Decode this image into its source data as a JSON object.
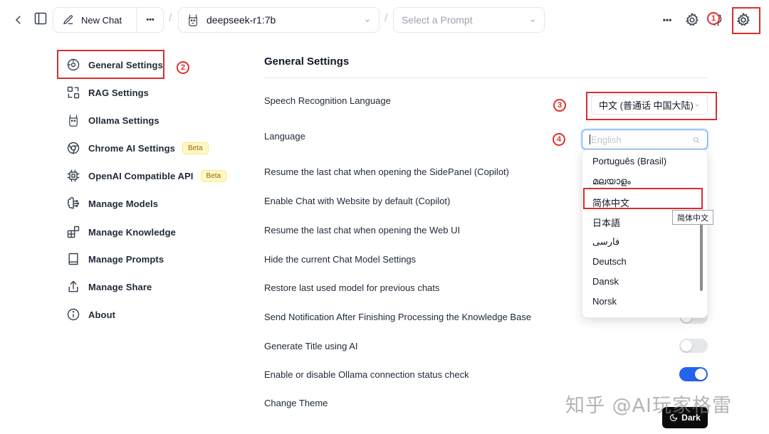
{
  "topbar": {
    "new_chat_label": "New Chat",
    "model_label": "deepseek-r1:7b",
    "prompt_placeholder": "Select a Prompt",
    "more_label": "•••",
    "separator": "/"
  },
  "sidebar": {
    "items": [
      {
        "label": "General Settings",
        "icon": "general-settings-icon"
      },
      {
        "label": "RAG Settings",
        "icon": "rag-icon"
      },
      {
        "label": "Ollama Settings",
        "icon": "ollama-icon"
      },
      {
        "label": "Chrome AI Settings",
        "icon": "chrome-icon",
        "badge": "Beta"
      },
      {
        "label": "OpenAI Compatible API",
        "icon": "cpu-icon",
        "badge": "Beta"
      },
      {
        "label": "Manage Models",
        "icon": "brain-icon"
      },
      {
        "label": "Manage Knowledge",
        "icon": "blocks-icon"
      },
      {
        "label": "Manage Prompts",
        "icon": "book-icon"
      },
      {
        "label": "Manage Share",
        "icon": "share-icon"
      },
      {
        "label": "About",
        "icon": "info-icon"
      }
    ]
  },
  "main": {
    "title": "General Settings",
    "rows": [
      {
        "label": "Speech Recognition Language"
      },
      {
        "label": "Language"
      },
      {
        "label": "Resume the last chat when opening the SidePanel (Copilot)"
      },
      {
        "label": "Enable Chat with Website by default (Copilot)"
      },
      {
        "label": "Resume the last chat when opening the Web UI"
      },
      {
        "label": "Hide the current Chat Model Settings"
      },
      {
        "label": "Restore last used model for previous chats"
      },
      {
        "label": "Send Notification After Finishing Processing the Knowledge Base",
        "toggle": false
      },
      {
        "label": "Generate Title using AI",
        "toggle": false
      },
      {
        "label": "Enable or disable Ollama connection status check",
        "toggle": true
      },
      {
        "label": "Change Theme"
      }
    ],
    "speech_language_value": "中文 (普通话 中国大陆)",
    "language_search_placeholder": "English",
    "theme_button": "Dark"
  },
  "language_dropdown": {
    "options": [
      "Português (Brasil)",
      "മലയാളം",
      "简体中文",
      "日本語",
      "فارسی",
      "Deutsch",
      "Dansk",
      "Norsk"
    ],
    "highlighted": "简体中文",
    "tooltip": "简体中文"
  },
  "annotations": {
    "n1": "1",
    "n2": "2",
    "n3": "3",
    "n4": "4",
    "color": "#d92d2d"
  },
  "watermark": "知乎 @AI玩家格雷",
  "colors": {
    "accent": "#2563eb",
    "toggle_off": "#e5e7eb",
    "beta_bg": "#fef9c3"
  }
}
